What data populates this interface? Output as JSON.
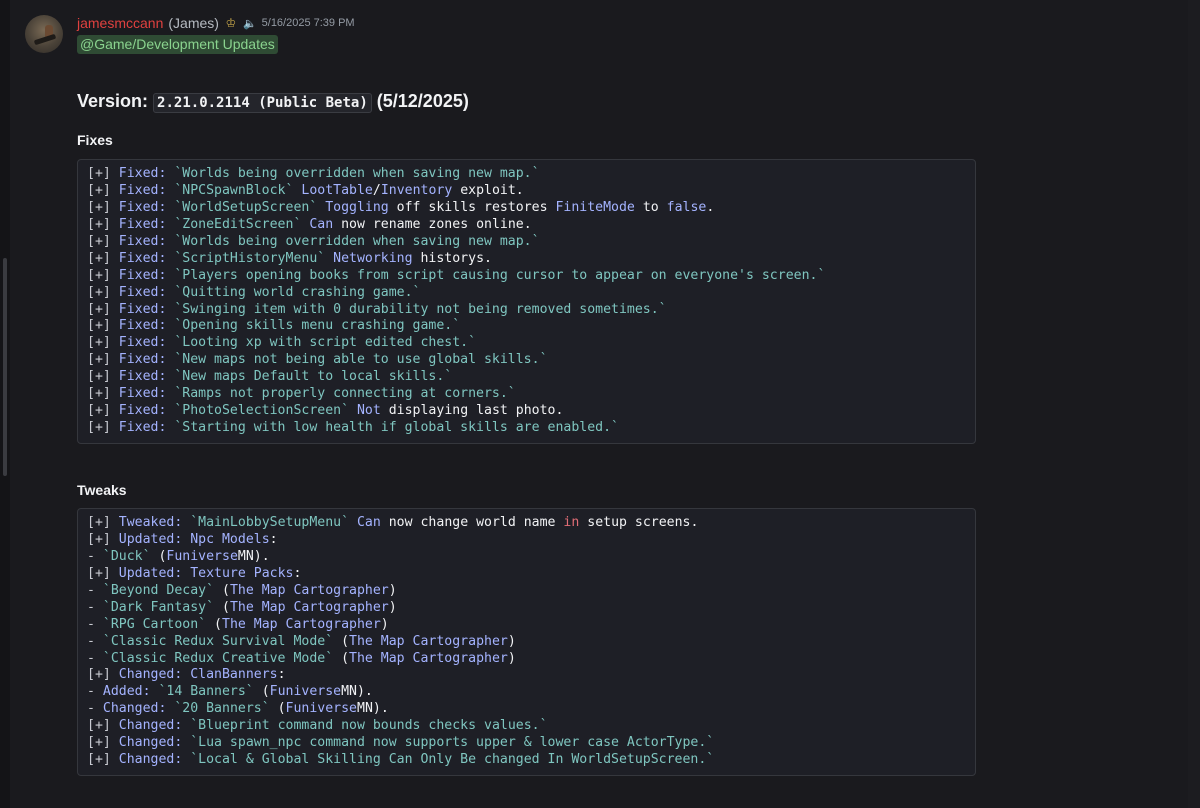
{
  "message": {
    "username": "jamesmccann",
    "real_name": "(James)",
    "timestamp": "5/16/2025 7:39 PM",
    "mention": "@Game/Development Updates",
    "version_label": "Version:",
    "version_code": "2.21.0.2114 (Public Beta)",
    "version_date": "(5/12/2025)",
    "fixes_title": "Fixes",
    "tweaks_title": "Tweaks"
  },
  "fixes": [
    [
      [
        "k",
        "[+] "
      ],
      [
        "lbl",
        "Fixed:"
      ],
      [
        "str",
        " `Worlds being overridden when saving new map.`"
      ]
    ],
    [
      [
        "k",
        "[+] "
      ],
      [
        "lbl",
        "Fixed:"
      ],
      [
        "str",
        " `NPCSpawnBlock`"
      ],
      [
        "ident",
        " LootTable"
      ],
      [
        "pl",
        "/"
      ],
      [
        "ident",
        "Inventory"
      ],
      [
        "pl",
        " exploit."
      ]
    ],
    [
      [
        "k",
        "[+] "
      ],
      [
        "lbl",
        "Fixed:"
      ],
      [
        "str",
        " `WorldSetupScreen`"
      ],
      [
        "ident",
        " Toggling"
      ],
      [
        "pl",
        " off skills restores "
      ],
      [
        "ident",
        "FiniteMode"
      ],
      [
        "pl",
        " to "
      ],
      [
        "ident",
        "false"
      ],
      [
        "pl",
        "."
      ]
    ],
    [
      [
        "k",
        "[+] "
      ],
      [
        "lbl",
        "Fixed:"
      ],
      [
        "str",
        " `ZoneEditScreen`"
      ],
      [
        "ident",
        " Can"
      ],
      [
        "pl",
        " now rename zones online."
      ]
    ],
    [
      [
        "k",
        "[+] "
      ],
      [
        "lbl",
        "Fixed:"
      ],
      [
        "str",
        " `Worlds being overridden when saving new map.`"
      ]
    ],
    [
      [
        "k",
        "[+] "
      ],
      [
        "lbl",
        "Fixed:"
      ],
      [
        "str",
        " `ScriptHistoryMenu`"
      ],
      [
        "ident",
        " Networking"
      ],
      [
        "pl",
        " historys."
      ]
    ],
    [
      [
        "k",
        "[+] "
      ],
      [
        "lbl",
        "Fixed:"
      ],
      [
        "str",
        " `Players opening books from script causing cursor to appear on everyone's screen.`"
      ]
    ],
    [
      [
        "k",
        "[+] "
      ],
      [
        "lbl",
        "Fixed:"
      ],
      [
        "str",
        " `Quitting world crashing game.`"
      ]
    ],
    [
      [
        "k",
        "[+] "
      ],
      [
        "lbl",
        "Fixed:"
      ],
      [
        "str",
        " `Swinging item with 0 durability not being removed sometimes.`"
      ]
    ],
    [
      [
        "k",
        "[+] "
      ],
      [
        "lbl",
        "Fixed:"
      ],
      [
        "str",
        " `Opening skills menu crashing game.`"
      ]
    ],
    [
      [
        "k",
        "[+] "
      ],
      [
        "lbl",
        "Fixed:"
      ],
      [
        "str",
        " `Looting xp with script edited chest.`"
      ]
    ],
    [
      [
        "k",
        "[+] "
      ],
      [
        "lbl",
        "Fixed:"
      ],
      [
        "str",
        " `New maps not being able to use global skills.`"
      ]
    ],
    [
      [
        "k",
        "[+] "
      ],
      [
        "lbl",
        "Fixed:"
      ],
      [
        "str",
        " `New maps Default to local skills.`"
      ]
    ],
    [
      [
        "k",
        "[+] "
      ],
      [
        "lbl",
        "Fixed:"
      ],
      [
        "str",
        " `Ramps not properly connecting at corners.`"
      ]
    ],
    [
      [
        "k",
        "[+] "
      ],
      [
        "lbl",
        "Fixed:"
      ],
      [
        "str",
        " `PhotoSelectionScreen`"
      ],
      [
        "ident",
        " Not"
      ],
      [
        "pl",
        " displaying last photo."
      ]
    ],
    [
      [
        "k",
        "[+] "
      ],
      [
        "lbl",
        "Fixed:"
      ],
      [
        "str",
        " `Starting with low health if global skills are enabled.`"
      ]
    ]
  ],
  "tweaks": [
    [
      [
        "k",
        "[+] "
      ],
      [
        "lbl",
        "Tweaked:"
      ],
      [
        "str",
        " `MainLobbySetupMenu`"
      ],
      [
        "ident",
        " Can"
      ],
      [
        "pl",
        " now change world name "
      ],
      [
        "kw",
        "in"
      ],
      [
        "pl",
        " setup screens."
      ]
    ],
    [
      [
        "k",
        "[+] "
      ],
      [
        "lbl",
        "Updated:"
      ],
      [
        "lbl",
        " Npc Models"
      ],
      [
        "pl",
        ":"
      ]
    ],
    [
      [
        "k",
        "- "
      ],
      [
        "str",
        "`Duck`"
      ],
      [
        "pl",
        " ("
      ],
      [
        "ident",
        "Funiverse"
      ],
      [
        "pl",
        "MN)."
      ]
    ],
    [
      [
        "k",
        "[+] "
      ],
      [
        "lbl",
        "Updated:"
      ],
      [
        "lbl",
        " Texture Packs"
      ],
      [
        "pl",
        ":"
      ]
    ],
    [
      [
        "k",
        "- "
      ],
      [
        "str",
        "`Beyond Decay`"
      ],
      [
        "pl",
        " ("
      ],
      [
        "ident",
        "The Map Cartographer"
      ],
      [
        "pl",
        ")"
      ]
    ],
    [
      [
        "k",
        "- "
      ],
      [
        "str",
        "`Dark Fantasy`"
      ],
      [
        "pl",
        " ("
      ],
      [
        "ident",
        "The Map Cartographer"
      ],
      [
        "pl",
        ")"
      ]
    ],
    [
      [
        "k",
        "- "
      ],
      [
        "str",
        "`RPG Cartoon`"
      ],
      [
        "pl",
        " ("
      ],
      [
        "ident",
        "The Map Cartographer"
      ],
      [
        "pl",
        ")"
      ]
    ],
    [
      [
        "k",
        "- "
      ],
      [
        "str",
        "`Classic Redux Survival Mode`"
      ],
      [
        "pl",
        " ("
      ],
      [
        "ident",
        "The Map Cartographer"
      ],
      [
        "pl",
        ")"
      ]
    ],
    [
      [
        "k",
        "- "
      ],
      [
        "str",
        "`Classic Redux Creative Mode`"
      ],
      [
        "pl",
        " ("
      ],
      [
        "ident",
        "The Map Cartographer"
      ],
      [
        "pl",
        ")"
      ]
    ],
    [
      [
        "k",
        "[+] "
      ],
      [
        "lbl",
        "Changed:"
      ],
      [
        "lbl",
        " ClanBanners"
      ],
      [
        "pl",
        ":"
      ]
    ],
    [
      [
        "k",
        "- "
      ],
      [
        "lbl",
        "Added:"
      ],
      [
        "str",
        " `14 Banners`"
      ],
      [
        "pl",
        " ("
      ],
      [
        "ident",
        "Funiverse"
      ],
      [
        "pl",
        "MN)."
      ]
    ],
    [
      [
        "k",
        "- "
      ],
      [
        "lbl",
        "Changed:"
      ],
      [
        "str",
        " `20 Banners`"
      ],
      [
        "pl",
        " ("
      ],
      [
        "ident",
        "Funiverse"
      ],
      [
        "pl",
        "MN)."
      ]
    ],
    [
      [
        "k",
        "[+] "
      ],
      [
        "lbl",
        "Changed:"
      ],
      [
        "str",
        " `Blueprint command now bounds checks values.`"
      ]
    ],
    [
      [
        "k",
        "[+] "
      ],
      [
        "lbl",
        "Changed:"
      ],
      [
        "str",
        " `Lua spawn_npc command now supports upper & lower case ActorType.`"
      ]
    ],
    [
      [
        "k",
        "[+] "
      ],
      [
        "lbl",
        "Changed:"
      ],
      [
        "str",
        " `Local & Global Skilling Can Only Be changed In WorldSetupScreen.`"
      ]
    ]
  ]
}
